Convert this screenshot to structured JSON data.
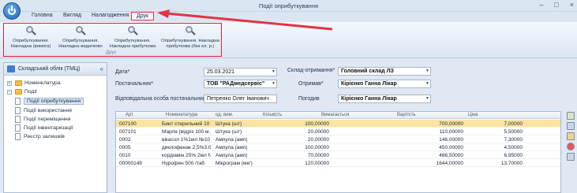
{
  "window": {
    "title": "Події оприбуткування"
  },
  "menu": {
    "tabs": [
      "Головна",
      "Вигляд",
      "Налагодження",
      "Друк"
    ],
    "active": "Друк"
  },
  "ribbon": {
    "buttons": [
      {
        "label_line1": "Оприбуткування.",
        "label_line2": "Накладна (вимога)"
      },
      {
        "label_line1": "Оприбуткування.",
        "label_line2": "Накладна видатково"
      },
      {
        "label_line1": "Оприбуткування.",
        "label_line2": "Накладна прибуткова"
      },
      {
        "label_line1": "Оприбуткування. Накладна",
        "label_line2": "прибуткова (без ел. р.)"
      }
    ],
    "group_label": "Друк"
  },
  "sidebar": {
    "header": "Складський облік (ТМЦ)",
    "items": [
      {
        "label": "Номенклатура",
        "expander": "+"
      },
      {
        "label": "Події",
        "expander": "−"
      },
      {
        "label": "Події оприбуткування",
        "selected": true
      },
      {
        "label": "Події використання"
      },
      {
        "label": "Події переміщення"
      },
      {
        "label": "Події інвентаризації"
      },
      {
        "label": "Реєстр залишків"
      }
    ]
  },
  "form": {
    "date_label": "Дата*",
    "date_value": "25.03.2021",
    "warehouse_label": "Склад-отримання*",
    "warehouse_value": "Головний склад ЛЗ",
    "supplier_label": "Постачальник*",
    "supplier_value": "ТОВ \"РАДмедсервіс\"",
    "receiver_label": "Отримав*",
    "receiver_value": "Кірієнко Ганна Лікар",
    "responsible_label": "Відповідальна особа постачальника",
    "responsible_value": "Петренко Олег Іванович",
    "approved_label": "Погодив",
    "approved_value": "Кірієнко Ганна Лікар"
  },
  "table": {
    "columns": [
      "Арт",
      "Номенклатура",
      "од. вим.",
      "Кількість",
      "Вимагається",
      "Вартість",
      "Ціна"
    ],
    "rows": [
      [
        "007100",
        "Бинт стерильний 10 м...",
        "Штука (шт)",
        "100,00000",
        "",
        "700,00000",
        "7,00000"
      ],
      [
        "007101",
        "Марля (відріз 100 м.)",
        "Штука (шт)",
        "20,00000",
        "",
        "110,00000",
        "5,50000"
      ],
      [
        "0002",
        "вікасол 1%1мл №10",
        "Ампула (амп)",
        "20,00000",
        "",
        "146,00000",
        "7,30000"
      ],
      [
        "0005",
        "диклофенак 2,5%3,0...",
        "Ампула (амп)",
        "100,00000",
        "",
        "450,00000",
        "4,50000"
      ],
      [
        "0010",
        "кордіамін 25% 2мл №...",
        "Ампула (амп)",
        "70,00000",
        "",
        "486,50000",
        "6,95000"
      ],
      [
        "00000149",
        "Нурофен 500 /таб",
        "Мікрограм (мкг)",
        "120,00000",
        "",
        "1644,00000",
        "13,70000"
      ]
    ]
  },
  "colors": {
    "highlight": "#e23444",
    "selected_row": "#fbe4a1"
  }
}
